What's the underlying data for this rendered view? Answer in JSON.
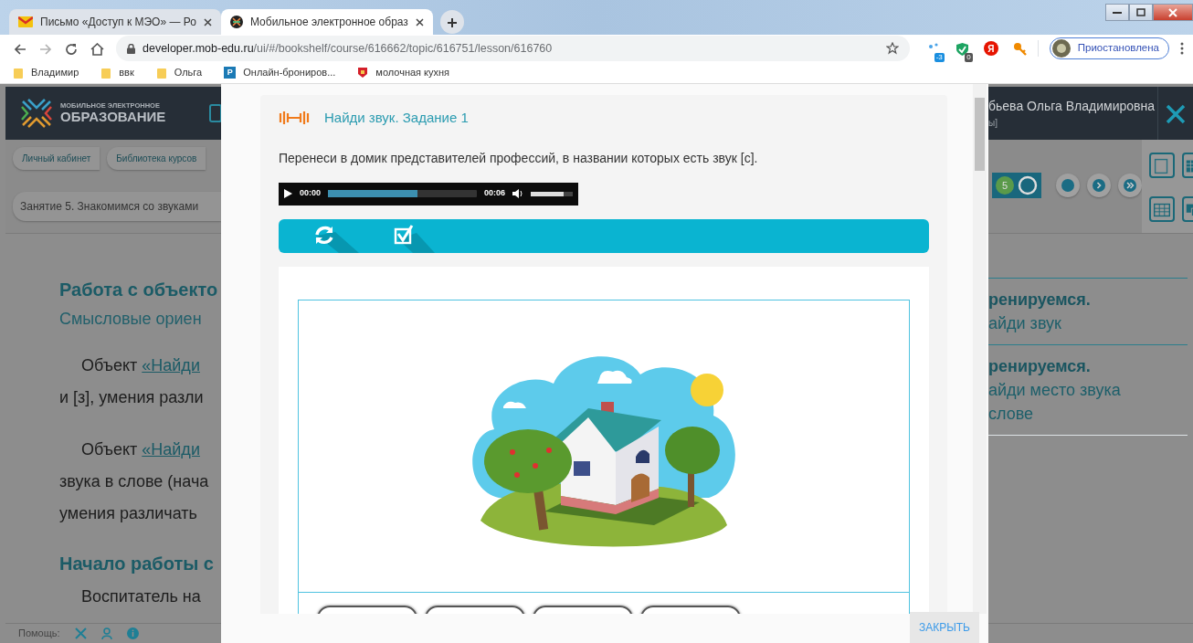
{
  "browser": {
    "tabs": [
      {
        "kind": "mail",
        "title": "Письмо «Доступ к МЭО» — Ро",
        "selected": false
      },
      {
        "kind": "site",
        "title": "Мобильное электронное образ",
        "selected": true
      }
    ],
    "forward_disabled": true,
    "url_host": "developer.mob-edu.ru",
    "url_path": "/ui/#/bookshelf/course/616662/topic/616751/lesson/616760",
    "extensions": [
      {
        "kind": "dots",
        "badge": "-3"
      },
      {
        "kind": "shield",
        "badge": "0"
      },
      {
        "kind": "yandex",
        "label": "Я"
      },
      {
        "kind": "key"
      }
    ],
    "profile": "Приостановлена",
    "bookmarks": [
      {
        "kind": "folder",
        "label": "Владимир"
      },
      {
        "kind": "folder",
        "label": "ввк"
      },
      {
        "kind": "folder",
        "label": "Ольга"
      },
      {
        "kind": "site",
        "icon_text": "P",
        "label": "Онлайн-брониров..."
      },
      {
        "kind": "emblem",
        "label": "молочная кухня"
      }
    ]
  },
  "page": {
    "logo_small": "МОБИЛЬНОЕ ЭЛЕКТРОННОЕ",
    "logo_big": "ОБРАЗОВАНИЕ",
    "user_name": "бьева Ольга Владимировна",
    "user_role": "ы]",
    "breadcrumbs": [
      "Личный кабинет",
      "Библиотека курсов"
    ],
    "lesson": "Занятие 5. Знакомимся со звуками",
    "progress_count": "5",
    "content": [
      {
        "kind": "heading",
        "text": "Работа с объекто"
      },
      {
        "kind": "subheading",
        "text": "Смысловые ориен"
      },
      {
        "kind": "paragraph",
        "lines": [
          {
            "text": "Объект ",
            "link": "«Найди"
          },
          {
            "text": "и [з], умения разли"
          }
        ]
      },
      {
        "kind": "paragraph",
        "lines": [
          {
            "text": "Объект ",
            "link": "«Найди"
          },
          {
            "text": "звука в слове (нача"
          },
          {
            "text": "умения различать"
          }
        ]
      },
      {
        "kind": "heading",
        "text": "Начало работы с"
      },
      {
        "kind": "paragraph",
        "lines": [
          {
            "text": "Воспитатель на"
          }
        ]
      }
    ],
    "side_items": [
      {
        "title": "ренируемся.",
        "lines": [
          "айди звук"
        ]
      },
      {
        "title": "ренируемся.",
        "lines": [
          "айди место звука",
          "слове"
        ]
      }
    ],
    "help_label": "Помощь:"
  },
  "modal": {
    "title": "Найди звук. Задание 1",
    "instruction": "Перенеси в домик представителей профессий, в названии которых есть звук [с].",
    "audio": {
      "current": "00:00",
      "duration": "00:06",
      "progress": {
        "level": 0.6
      },
      "volume": {
        "level": 0.78
      }
    },
    "word_cards": [
      {
        "kind": "blank"
      },
      {
        "kind": "blank"
      },
      {
        "kind": "blank"
      },
      {
        "kind": "blank"
      }
    ],
    "close": "ЗАКРЫТЬ"
  }
}
